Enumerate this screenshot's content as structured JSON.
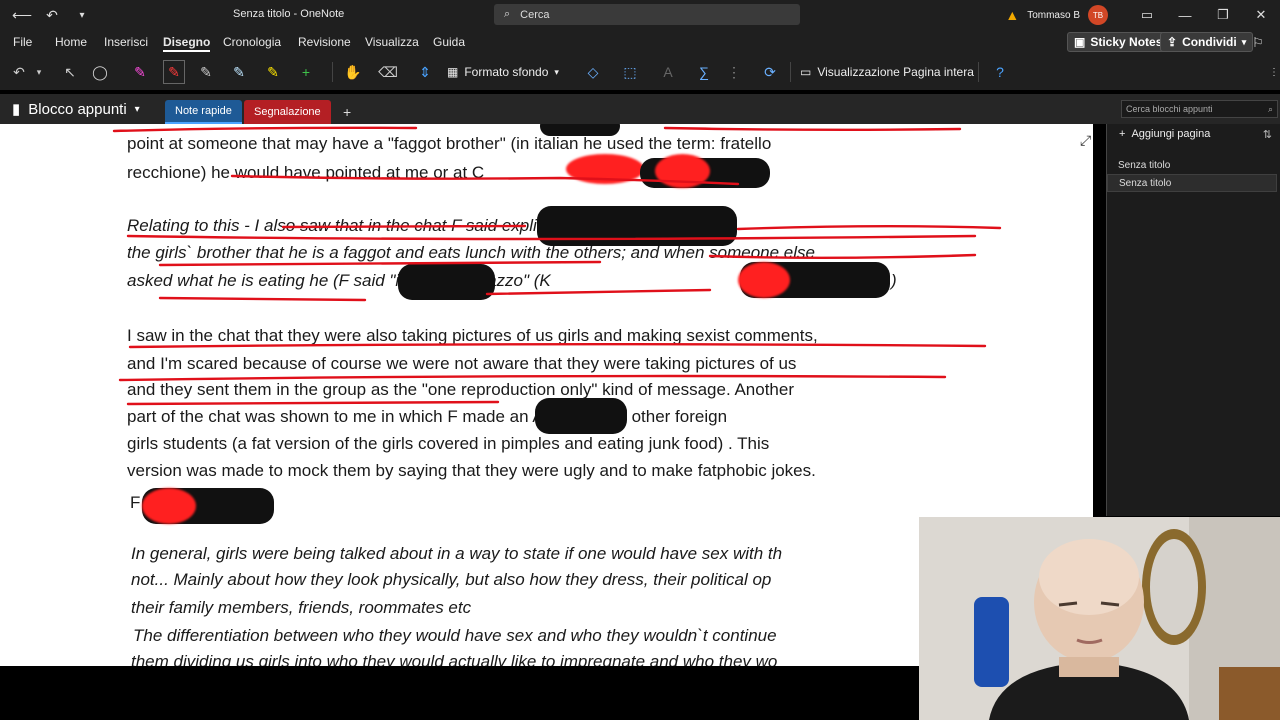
{
  "titlebar": {
    "title": "Senza titolo - OneNote",
    "search_placeholder": "Cerca",
    "user_name": "Tommaso B",
    "user_initials": "TB"
  },
  "menu": {
    "items": [
      "File",
      "Home",
      "Inserisci",
      "Disegno",
      "Cronologia",
      "Revisione",
      "Visualizza",
      "Guida"
    ],
    "active": "Disegno",
    "sticky_notes": "Sticky Notes",
    "share": "Condividi"
  },
  "ribbon": {
    "format_background": "Formato sfondo",
    "full_page_view": "Visualizzazione Pagina intera"
  },
  "notebook": {
    "name": "Blocco appunti",
    "tabs": [
      "Note rapide",
      "Segnalazione"
    ],
    "add_tab": "+",
    "search_placeholder": "Cerca blocchi appunti"
  },
  "pages": {
    "add_page": "Aggiungi pagina",
    "items": [
      "Senza titolo",
      "Senza titolo"
    ]
  },
  "document": {
    "lines": [
      "point at someone that may have a \"faggot brother\" (in italian he used the term: fratello",
      "recchione) he would have pointed at me or at C",
      "Relating to this - I also saw that in the chat F                              said explicitly about one of",
      "the girls` brother that he is a faggot and eats lunch with the others; and when someone else",
      "asked what he is eating he (F              said \"il mio gran cazzo\" (K",
      "I saw in the chat that they were also taking pictures of us girls and making sexist comments,",
      "and I'm scared because of course we were not aware that they were taking pictures of us",
      "and they sent them in the group as the \"one reproduction only\" kind of message. Another",
      "part of the chat was shown to me in which F               made an AI version of other foreign",
      "girls students (a fat version of the girls covered in pimples and eating junk food) . This",
      "version was made to mock them by saying that they were ugly and to make fatphobic jokes.",
      "F",
      "In general, girls were being talked about in a way to state if one would have sex with th",
      "not... Mainly about how they look physically, but also how they dress, their political op",
      "their family members, friends, roommates etc",
      "The differentiation between who they would have sex and who they wouldn`t continue",
      "them dividing us girls into who they would actually like to impregnate and who they wo"
    ],
    "partial_top": "F",
    "partial_line2_end": ")"
  },
  "colors": {
    "ink_red": "#e0101a",
    "accent_blue": "#1e5a96",
    "tab_red": "#b41f24"
  }
}
